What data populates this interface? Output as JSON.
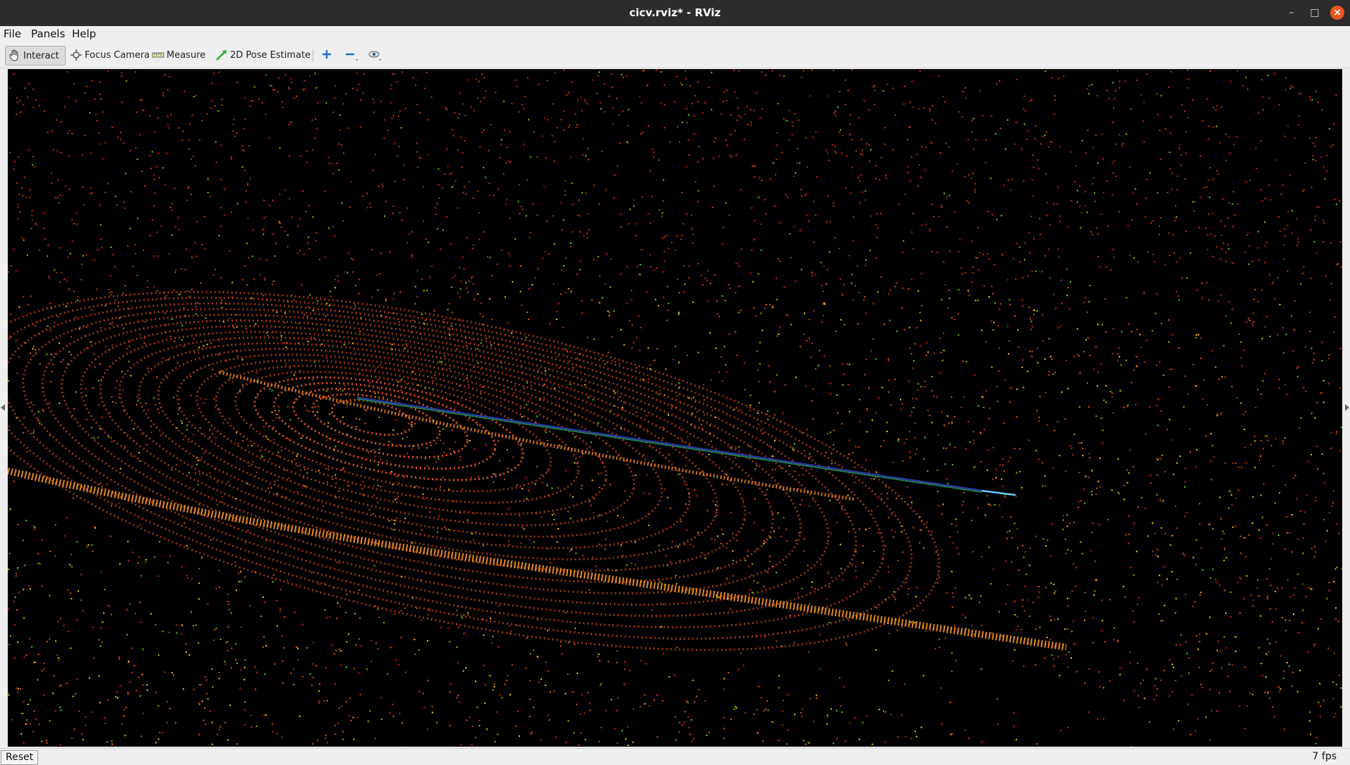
{
  "window": {
    "title": "cicv.rviz* - RViz"
  },
  "menu": [
    "File",
    "Panels",
    "Help"
  ],
  "toolbar": {
    "interact": "Interact",
    "focus_camera": "Focus Camera",
    "measure": "Measure",
    "pose_estimate": "2D Pose Estimate"
  },
  "status": {
    "reset": "Reset",
    "fps": "7 fps"
  },
  "colors": {
    "titlebar": "#2c2c2c",
    "close": "#e95420",
    "path": "#2b3a9a",
    "path_end": "#5fd0ff",
    "points_near": "#ff5a1f",
    "points_mid": "#ffb000",
    "points_far": "#c4360c"
  },
  "icons": [
    "hand-icon",
    "focus-camera-icon",
    "measure-icon",
    "pose-estimate-icon",
    "zoom-in-icon",
    "zoom-out-icon",
    "eye-icon",
    "close-icon"
  ]
}
